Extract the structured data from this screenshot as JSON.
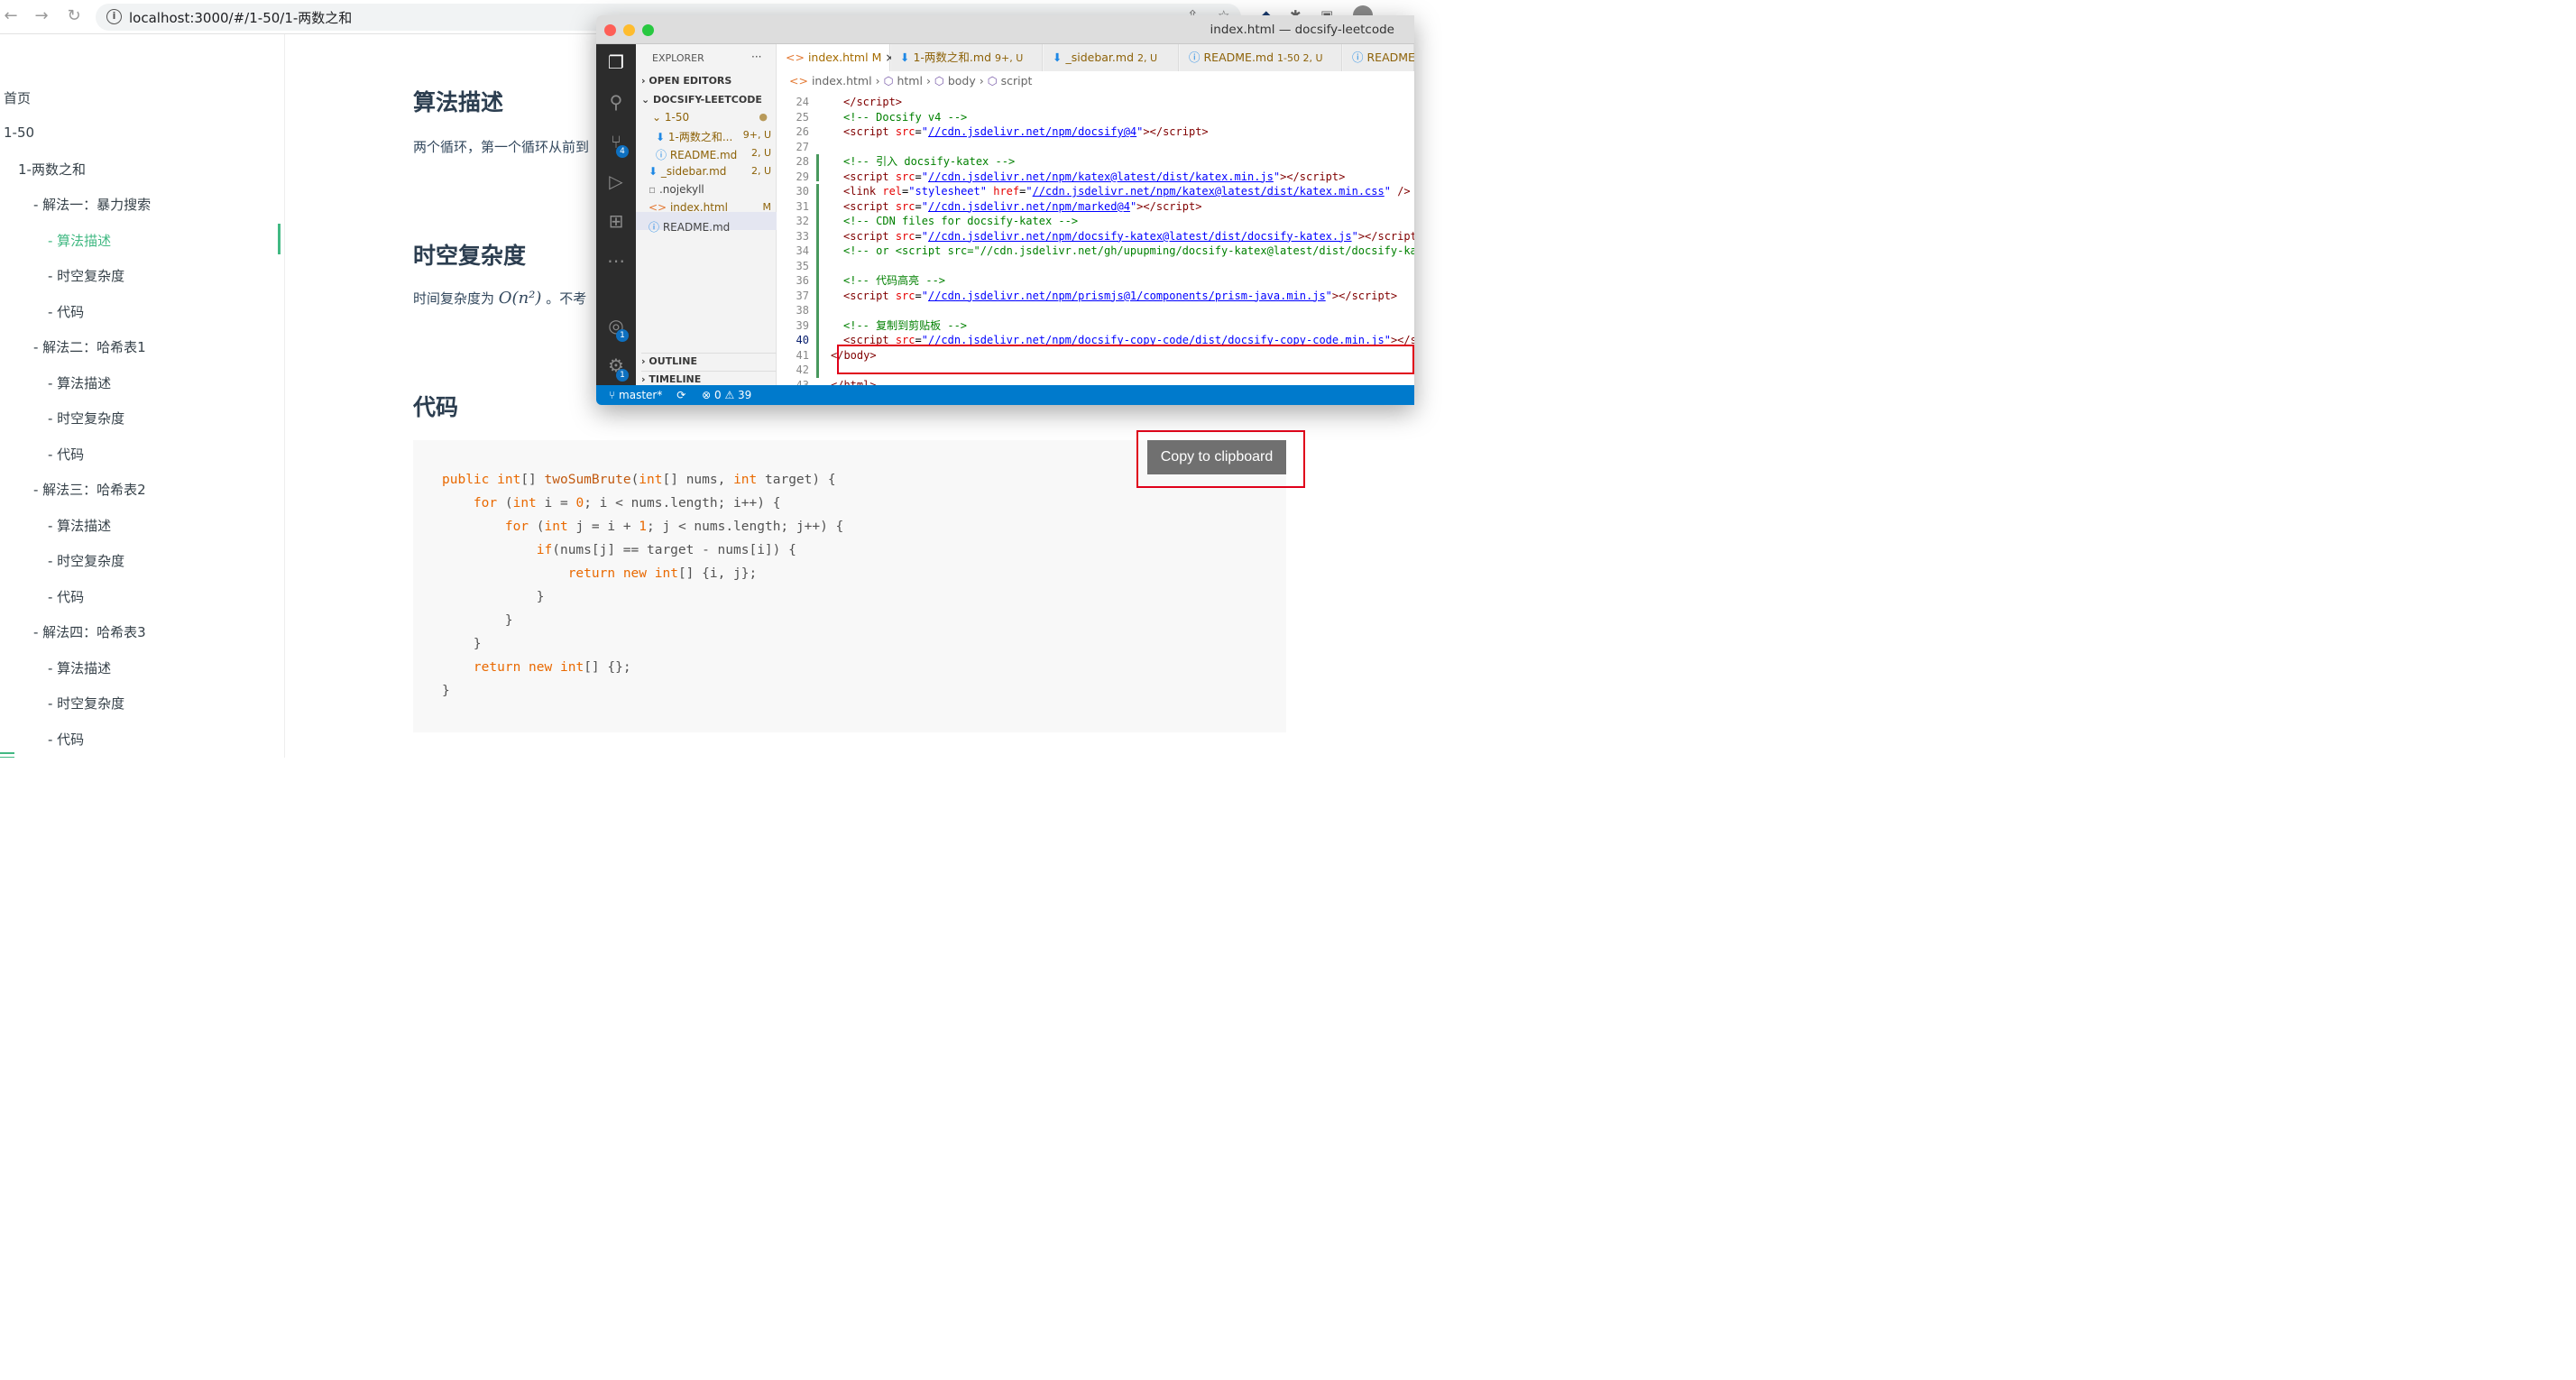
{
  "browser": {
    "back": "←",
    "forward": "→",
    "reload": "↻",
    "url": "localhost:3000/#/1-50/1-两数之和"
  },
  "sidebar": {
    "items": [
      {
        "label": "首页"
      },
      {
        "label": "1-50"
      },
      {
        "label": "1-两数之和"
      },
      {
        "label": "- 解法一：暴力搜索"
      },
      {
        "label": "- 算法描述",
        "active": true
      },
      {
        "label": "- 时空复杂度"
      },
      {
        "label": "- 代码"
      },
      {
        "label": "- 解法二：哈希表1"
      },
      {
        "label": "- 算法描述"
      },
      {
        "label": "- 时空复杂度"
      },
      {
        "label": "- 代码"
      },
      {
        "label": "- 解法三：哈希表2"
      },
      {
        "label": "- 算法描述"
      },
      {
        "label": "- 时空复杂度"
      },
      {
        "label": "- 代码"
      },
      {
        "label": "- 解法四：哈希表3"
      },
      {
        "label": "- 算法描述"
      },
      {
        "label": "- 时空复杂度"
      },
      {
        "label": "- 代码"
      }
    ]
  },
  "main": {
    "h_algo": "算法描述",
    "p_algo": "两个循环，第一个循环从前到",
    "h_complexity": "时空复杂度",
    "p_complexity_pre": "时间复杂度为",
    "p_complexity_math": "O(n²)",
    "p_complexity_post": "。不考",
    "h_code": "代码",
    "code_lines": [
      "public int[] twoSumBrute(int[] nums, int target) {",
      "    for (int i = 0; i < nums.length; i++) {",
      "        for (int j = i + 1; j < nums.length; j++) {",
      "            if(nums[j] == target - nums[i]) {",
      "                return new int[] {i, j};",
      "            }",
      "        }",
      "    }",
      "    return new int[] {};",
      "}"
    ],
    "copy_button": "Copy to clipboard"
  },
  "vscode": {
    "window_title": "index.html — docsify-leetcode",
    "explorer": {
      "title": "EXPLORER",
      "more": "···",
      "open_editors": "OPEN EDITORS",
      "root": "DOCSIFY-LEETCODE",
      "folder": "1-50",
      "files": [
        {
          "name": "1-两数之和...",
          "status": "9+, U"
        },
        {
          "name": "README.md",
          "status": "2, U"
        },
        {
          "name": "_sidebar.md",
          "status": "2, U"
        },
        {
          "name": ".nojekyll",
          "status": ""
        },
        {
          "name": "index.html",
          "status": "M"
        },
        {
          "name": "README.md",
          "status": ""
        }
      ],
      "outline": "OUTLINE",
      "timeline": "TIMELINE"
    },
    "activity_badges": {
      "scm": "4",
      "accounts": "1",
      "manage": "1"
    },
    "tabs": [
      {
        "name": "index.html",
        "status": "M",
        "close": "×"
      },
      {
        "name": "1-两数之和.md",
        "status": "9+, U"
      },
      {
        "name": "_sidebar.md",
        "status": "2, U"
      },
      {
        "name": "README.md",
        "status": "1-50  2, U"
      },
      {
        "name": "README.",
        "status": ""
      }
    ],
    "breadcrumb": [
      "index.html",
      "html",
      "body",
      "script"
    ],
    "line_numbers": [
      "24",
      "25",
      "26",
      "27",
      "28",
      "29",
      "30",
      "31",
      "32",
      "33",
      "34",
      "35",
      "36",
      "37",
      "38",
      "39",
      "40",
      "41",
      "42",
      "43"
    ],
    "status": {
      "branch": "master*",
      "sync": "⟳",
      "errors": "0",
      "warnings": "39"
    }
  }
}
